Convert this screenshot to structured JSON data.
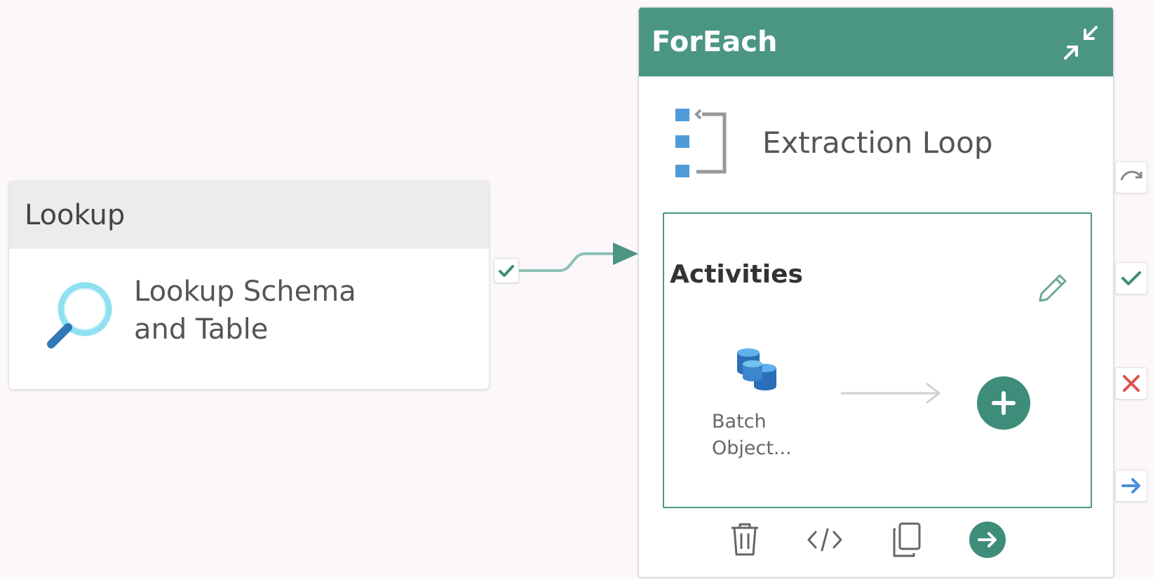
{
  "lookup_activity": {
    "type_label": "Lookup",
    "name_line1": "Lookup Schema",
    "name_line2": "and Table",
    "icon": "magnifier-icon"
  },
  "foreach_activity": {
    "type_label": "ForEach",
    "name": "Extraction Loop",
    "icon": "foreach-loop-icon",
    "header_color": "#4a9683",
    "activities": {
      "title": "Activities",
      "child_activity": {
        "label_line1": "Batch",
        "label_line2": "Object...",
        "icon": "database-stack-icon"
      }
    },
    "toolbar": [
      "delete-icon",
      "code-icon",
      "copy-icon",
      "go-to-icon"
    ]
  },
  "output_handles": [
    "skipped-icon",
    "success-icon",
    "failure-icon",
    "completion-icon"
  ],
  "colors": {
    "accent": "#4a9683",
    "success": "#3d8d7a",
    "failure": "#d9534f",
    "completion": "#4a90d9",
    "canvas": "#fbf7fb"
  }
}
